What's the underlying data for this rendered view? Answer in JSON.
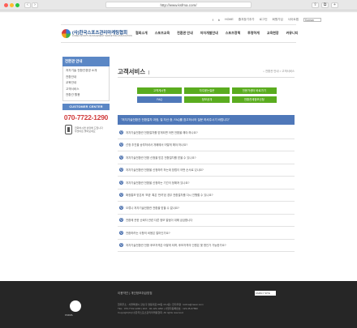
{
  "browser": {
    "url": "http://www.ksfma.com/",
    "nav_back": "‹",
    "nav_forward": "›",
    "share": "⇪",
    "tabs": "⧉",
    "add": "+"
  },
  "utility": {
    "links": [
      "HOME",
      "즐겨찾기추가",
      "로그인",
      "회원가입",
      "사이트맵"
    ],
    "language": "Korean"
  },
  "logo": {
    "name": "(사)한국스포츠관리마케팅협회",
    "sub": "KOREA SPORTS MANAGEMENT MARKETING ASSOCIATION"
  },
  "gnb": [
    "협회소개",
    "스포츠교육",
    "전환관 안내",
    "저자개발안내",
    "스포츠정책",
    "투명하게",
    "교육현장",
    "커뮤니티"
  ],
  "sidebar": {
    "title": "전환관 안내",
    "items": [
      "저자기술 전환관경영 소개",
      "전환안내",
      "교육안내",
      "고객서비스",
      "전환관 활용"
    ],
    "cs_title": "CUSTOMER CENTER",
    "phone": "070-7722-1290",
    "info": [
      "전화하시면 상담해 드립니다",
      "무엇이든 물어보세요"
    ]
  },
  "content": {
    "title": "고객서비스",
    "breadcrumb": "⌂ 전환관 안내 > 고객서비스",
    "tabs": [
      "고객게시판",
      "자주묻는질문",
      "전문가센터 바로가기",
      "FAQ",
      "정보공개",
      "전환관계정보신청"
    ],
    "notice": "\"저자기술전환관 전환절차 과정, 질 자산 중, FAQ를 참고하시어 질문 하셔주시기 바랍니다\"",
    "faqs": [
      "저자기술전환관 전환절차를 받게되면 어떤 전환을 해야 하나요?",
      "선정 추진을 송부하셔서 개폐에서 어떻게 해야 하나요?",
      "저자기술전환관 전환 신청을 받은 전환절차를 받을 수 있나요?",
      "저자기술전환관 전환을 신청하려 하는데 방법이 어떤 순서로 있나요?",
      "저자기술전환관 전환을 신청하는 기간이 정해져 있나요?",
      "확정통보 받은후 '보완' 혹은 '반려'된 경우 전환절차를 다시 진행할 수 있나요?",
      "오류나 저자기술전환관 전환을 받을 수 없나요?",
      "전환에 관한 순회자 관련 다른 정보 알림이 대해 궁금합니다",
      "전환하려는 사항의 비용은 얼마인가요?",
      "저자기술전환관 전환 후보자격은 어떻게 되며, 후보자격의 인원은 몇 명인가 가능한가요?"
    ]
  },
  "footer": {
    "links": "이용약관 | 개인정보취급방침",
    "family_select": "FAMILY SITE",
    "logo_text": "KSFMA",
    "address": [
      "협회주소 : 서울특별시 강남구 영동대로 89길 16 2층 | 전자우편 : ksfma@naver.com",
      "TEL : 070-7722-1290 | FAX : 02-123-1290 | 사업자등록번호 : 123-45-67890",
      "Copyright(C)(사)한국스포츠관리마케팅협회. All rights reserved."
    ]
  }
}
